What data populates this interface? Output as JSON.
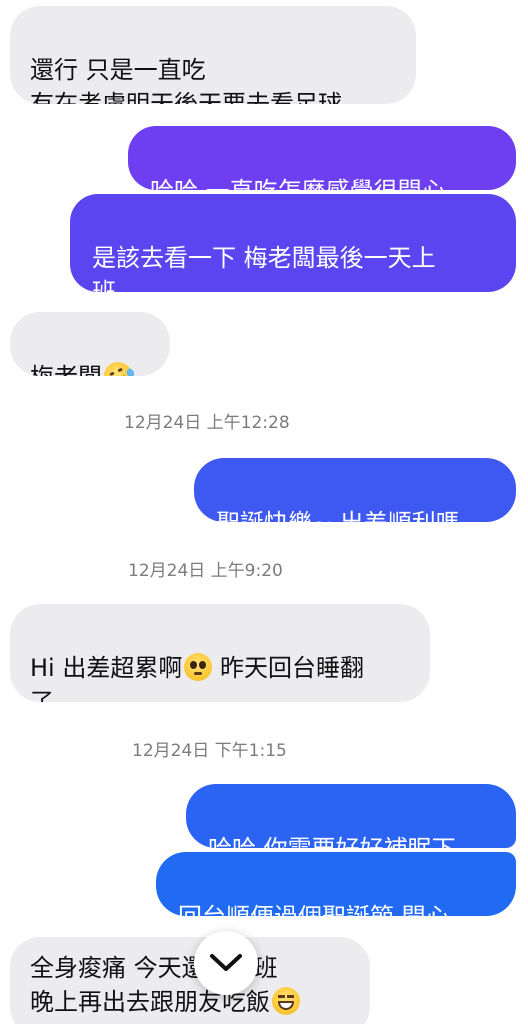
{
  "colors": {
    "received_bg": "#ececef",
    "sent_gradient_top": "#7b3cf2",
    "sent_gradient_bottom": "#1e6cf2",
    "timestamp": "#7c7c80"
  },
  "messages": [
    {
      "direction": "received",
      "text": "還行 只是一直吃\n有在考慮明天後天要去看足球",
      "emoji": ""
    },
    {
      "direction": "sent",
      "text": "哈哈 一直吃怎麼感覺很開心",
      "emoji": ""
    },
    {
      "direction": "sent",
      "text": "是該去看一下 梅老闆最後一天上\n班",
      "emoji": ""
    },
    {
      "direction": "received",
      "text": "梅老闆",
      "emoji": "rolling-on-floor-laughing-emoji"
    },
    {
      "direction": "timestamp",
      "text": "12月24日 上午12:28"
    },
    {
      "direction": "sent",
      "text": "聖誕快樂~ 出差順利嗎",
      "emoji": ""
    },
    {
      "direction": "timestamp",
      "text": "12月24日 上午9:20"
    },
    {
      "direction": "received",
      "text_before": "Hi 出差超累啊",
      "emoji": "pleading-face-emoji",
      "text_after": " 昨天回台睡翻\n了"
    },
    {
      "direction": "timestamp",
      "text": "12月24日 下午1:15"
    },
    {
      "direction": "sent",
      "text": "哈哈 你需要好好補眠下",
      "emoji": ""
    },
    {
      "direction": "sent",
      "text": "回台順便過個聖誕節 開心",
      "emoji": ""
    },
    {
      "direction": "received",
      "text_line1": "全身痠痛 今天還要加班",
      "text_line2": "晚上再出去跟朋友吃飯",
      "emoji": "grinning-squinting-face-emoji"
    }
  ],
  "scroll_button": {
    "icon": "chevron-down-icon"
  }
}
